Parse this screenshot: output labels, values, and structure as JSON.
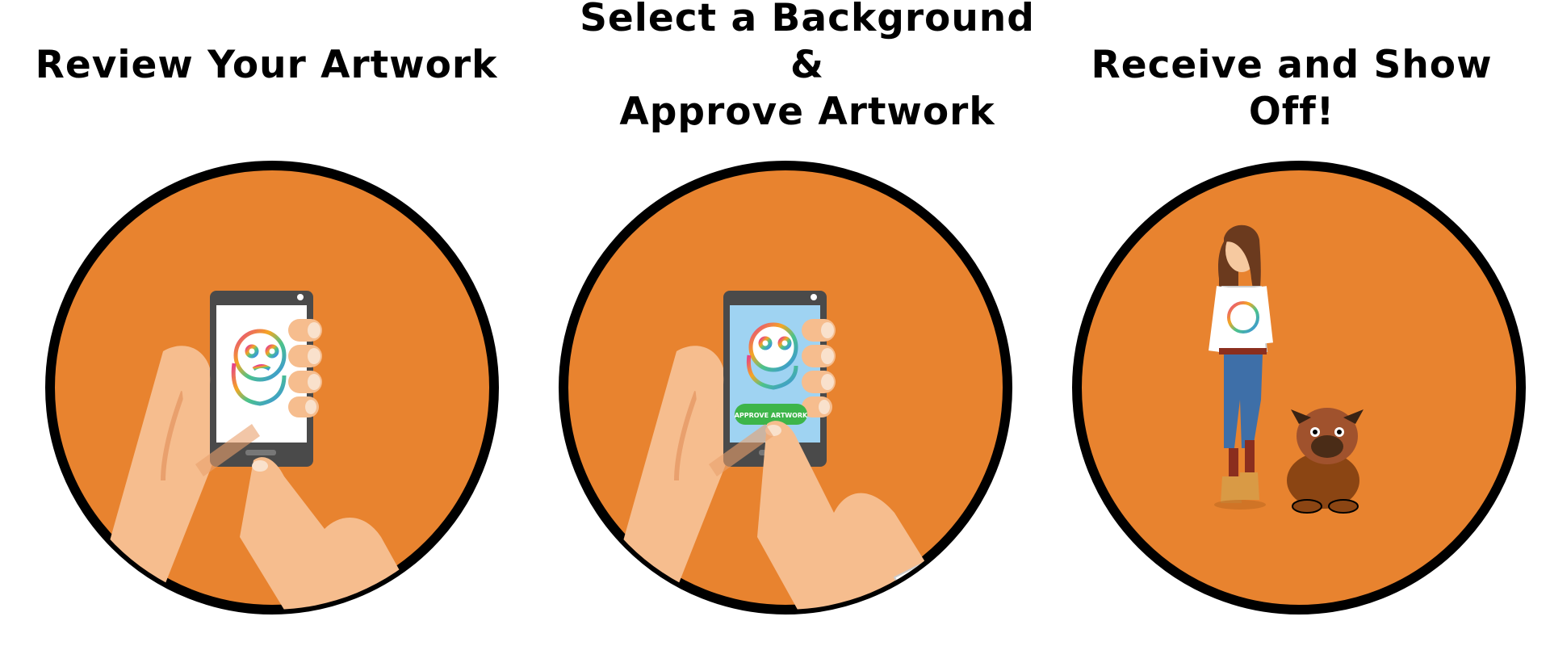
{
  "steps": [
    {
      "title_lines": [
        "Review Your Artwork"
      ]
    },
    {
      "title_lines": [
        "Select a Background",
        "&",
        "Approve Artwork"
      ],
      "button_label": "APPROVE ARTWORK"
    },
    {
      "title_lines": [
        "Receive and Show Off!"
      ]
    }
  ],
  "colors": {
    "circle_fill": "#E8832F",
    "circle_border": "#000000",
    "skin": "#F6BD8E",
    "skin_shadow": "#E9A06D",
    "phone_body": "#4A4A4A",
    "screen_white": "#FFFFFF",
    "screen_blue": "#9FD3F2",
    "approve_green": "#3DB54A"
  }
}
